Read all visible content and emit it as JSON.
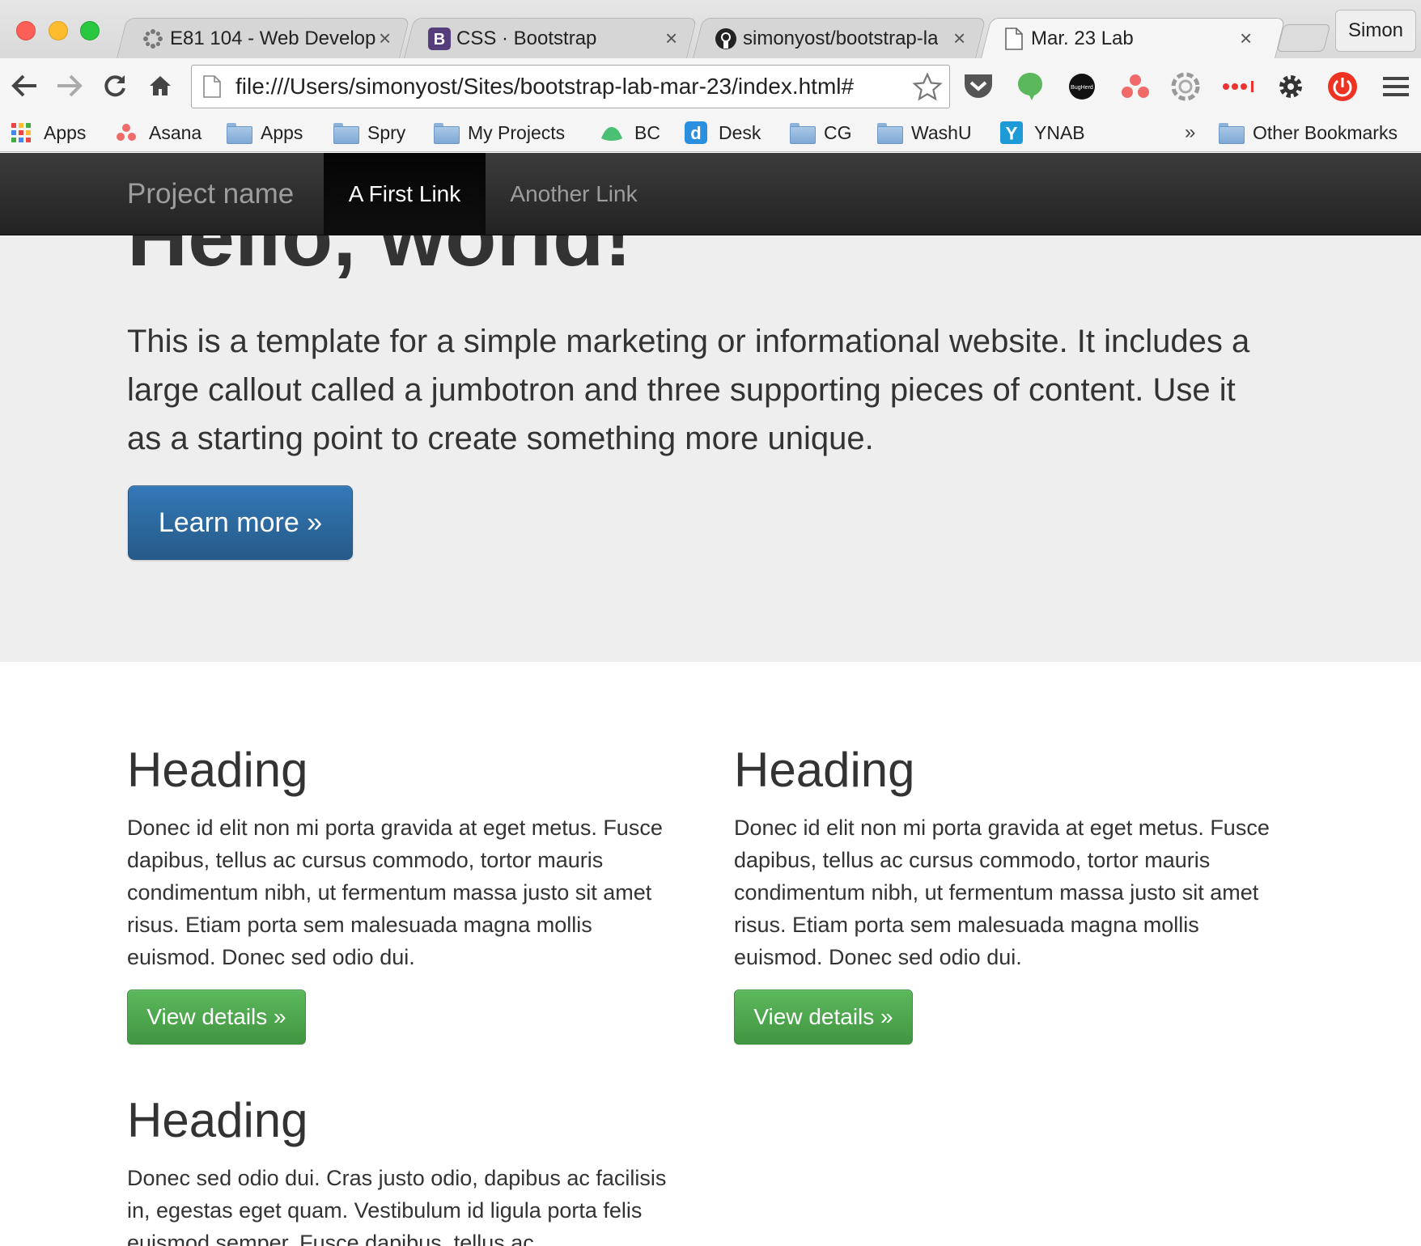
{
  "browser": {
    "tabs": [
      {
        "title": "E81 104 - Web Develop",
        "favicon": "canvas-icon",
        "active": false
      },
      {
        "title": "CSS · Bootstrap",
        "favicon": "bootstrap-icon",
        "active": false
      },
      {
        "title": "simonyost/bootstrap-la",
        "favicon": "github-icon",
        "active": false
      },
      {
        "title": "Mar. 23 Lab",
        "favicon": "page-icon",
        "active": true
      }
    ],
    "tab_close_glyph": "×",
    "profile_name": "Simon",
    "url": "file:///Users/simonyost/Sites/bootstrap-lab-mar-23/index.html#",
    "bookmarks": [
      {
        "label": "Apps",
        "icon": "apps-grid-icon"
      },
      {
        "label": "Asana",
        "icon": "asana-icon"
      },
      {
        "label": "Apps",
        "icon": "folder-icon"
      },
      {
        "label": "Spry",
        "icon": "folder-icon"
      },
      {
        "label": "My Projects",
        "icon": "folder-icon"
      },
      {
        "label": "BC",
        "icon": "basecamp-icon"
      },
      {
        "label": "Desk",
        "icon": "desk-icon"
      },
      {
        "label": "CG",
        "icon": "folder-icon"
      },
      {
        "label": "WashU",
        "icon": "folder-icon"
      },
      {
        "label": "YNAB",
        "icon": "ynab-icon"
      }
    ],
    "bookmarks_overflow": "»",
    "other_bookmarks": "Other Bookmarks",
    "extensions": [
      "pocket-icon",
      "evernote-icon",
      "bugherd-icon",
      "asana-icon",
      "aperture-icon",
      "more-dots-icon",
      "settings-icon",
      "power-icon",
      "menu-icon"
    ],
    "colors": {
      "accent_primary": "#337ab7",
      "accent_success": "#5cb85c",
      "navbar": "#222222",
      "jumbotron": "#eeeeee"
    }
  },
  "page": {
    "navbar": {
      "brand": "Project name",
      "links": [
        {
          "label": "A First Link",
          "active": true
        },
        {
          "label": "Another Link",
          "active": false
        }
      ]
    },
    "jumbotron": {
      "title": "Hello, world!",
      "lead": "This is a template for a simple marketing or informational website. It includes a large callout called a jumbotron and three supporting pieces of content. Use it as a starting point to create something more unique.",
      "button": "Learn more »"
    },
    "columns": [
      {
        "heading": "Heading",
        "text": "Donec id elit non mi porta gravida at eget metus. Fusce dapibus, tellus ac cursus commodo, tortor mauris condimentum nibh, ut fermentum massa justo sit amet risus. Etiam porta sem malesuada magna mollis euismod. Donec sed odio dui.",
        "button": "View details »"
      },
      {
        "heading": "Heading",
        "text": "Donec id elit non mi porta gravida at eget metus. Fusce dapibus, tellus ac cursus commodo, tortor mauris condimentum nibh, ut fermentum massa justo sit amet risus. Etiam porta sem malesuada magna mollis euismod. Donec sed odio dui.",
        "button": "View details »"
      },
      {
        "heading": "Heading",
        "text": "Donec sed odio dui. Cras justo odio, dapibus ac facilisis in, egestas eget quam. Vestibulum id ligula porta felis euismod semper. Fusce dapibus, tellus ac"
      }
    ]
  }
}
